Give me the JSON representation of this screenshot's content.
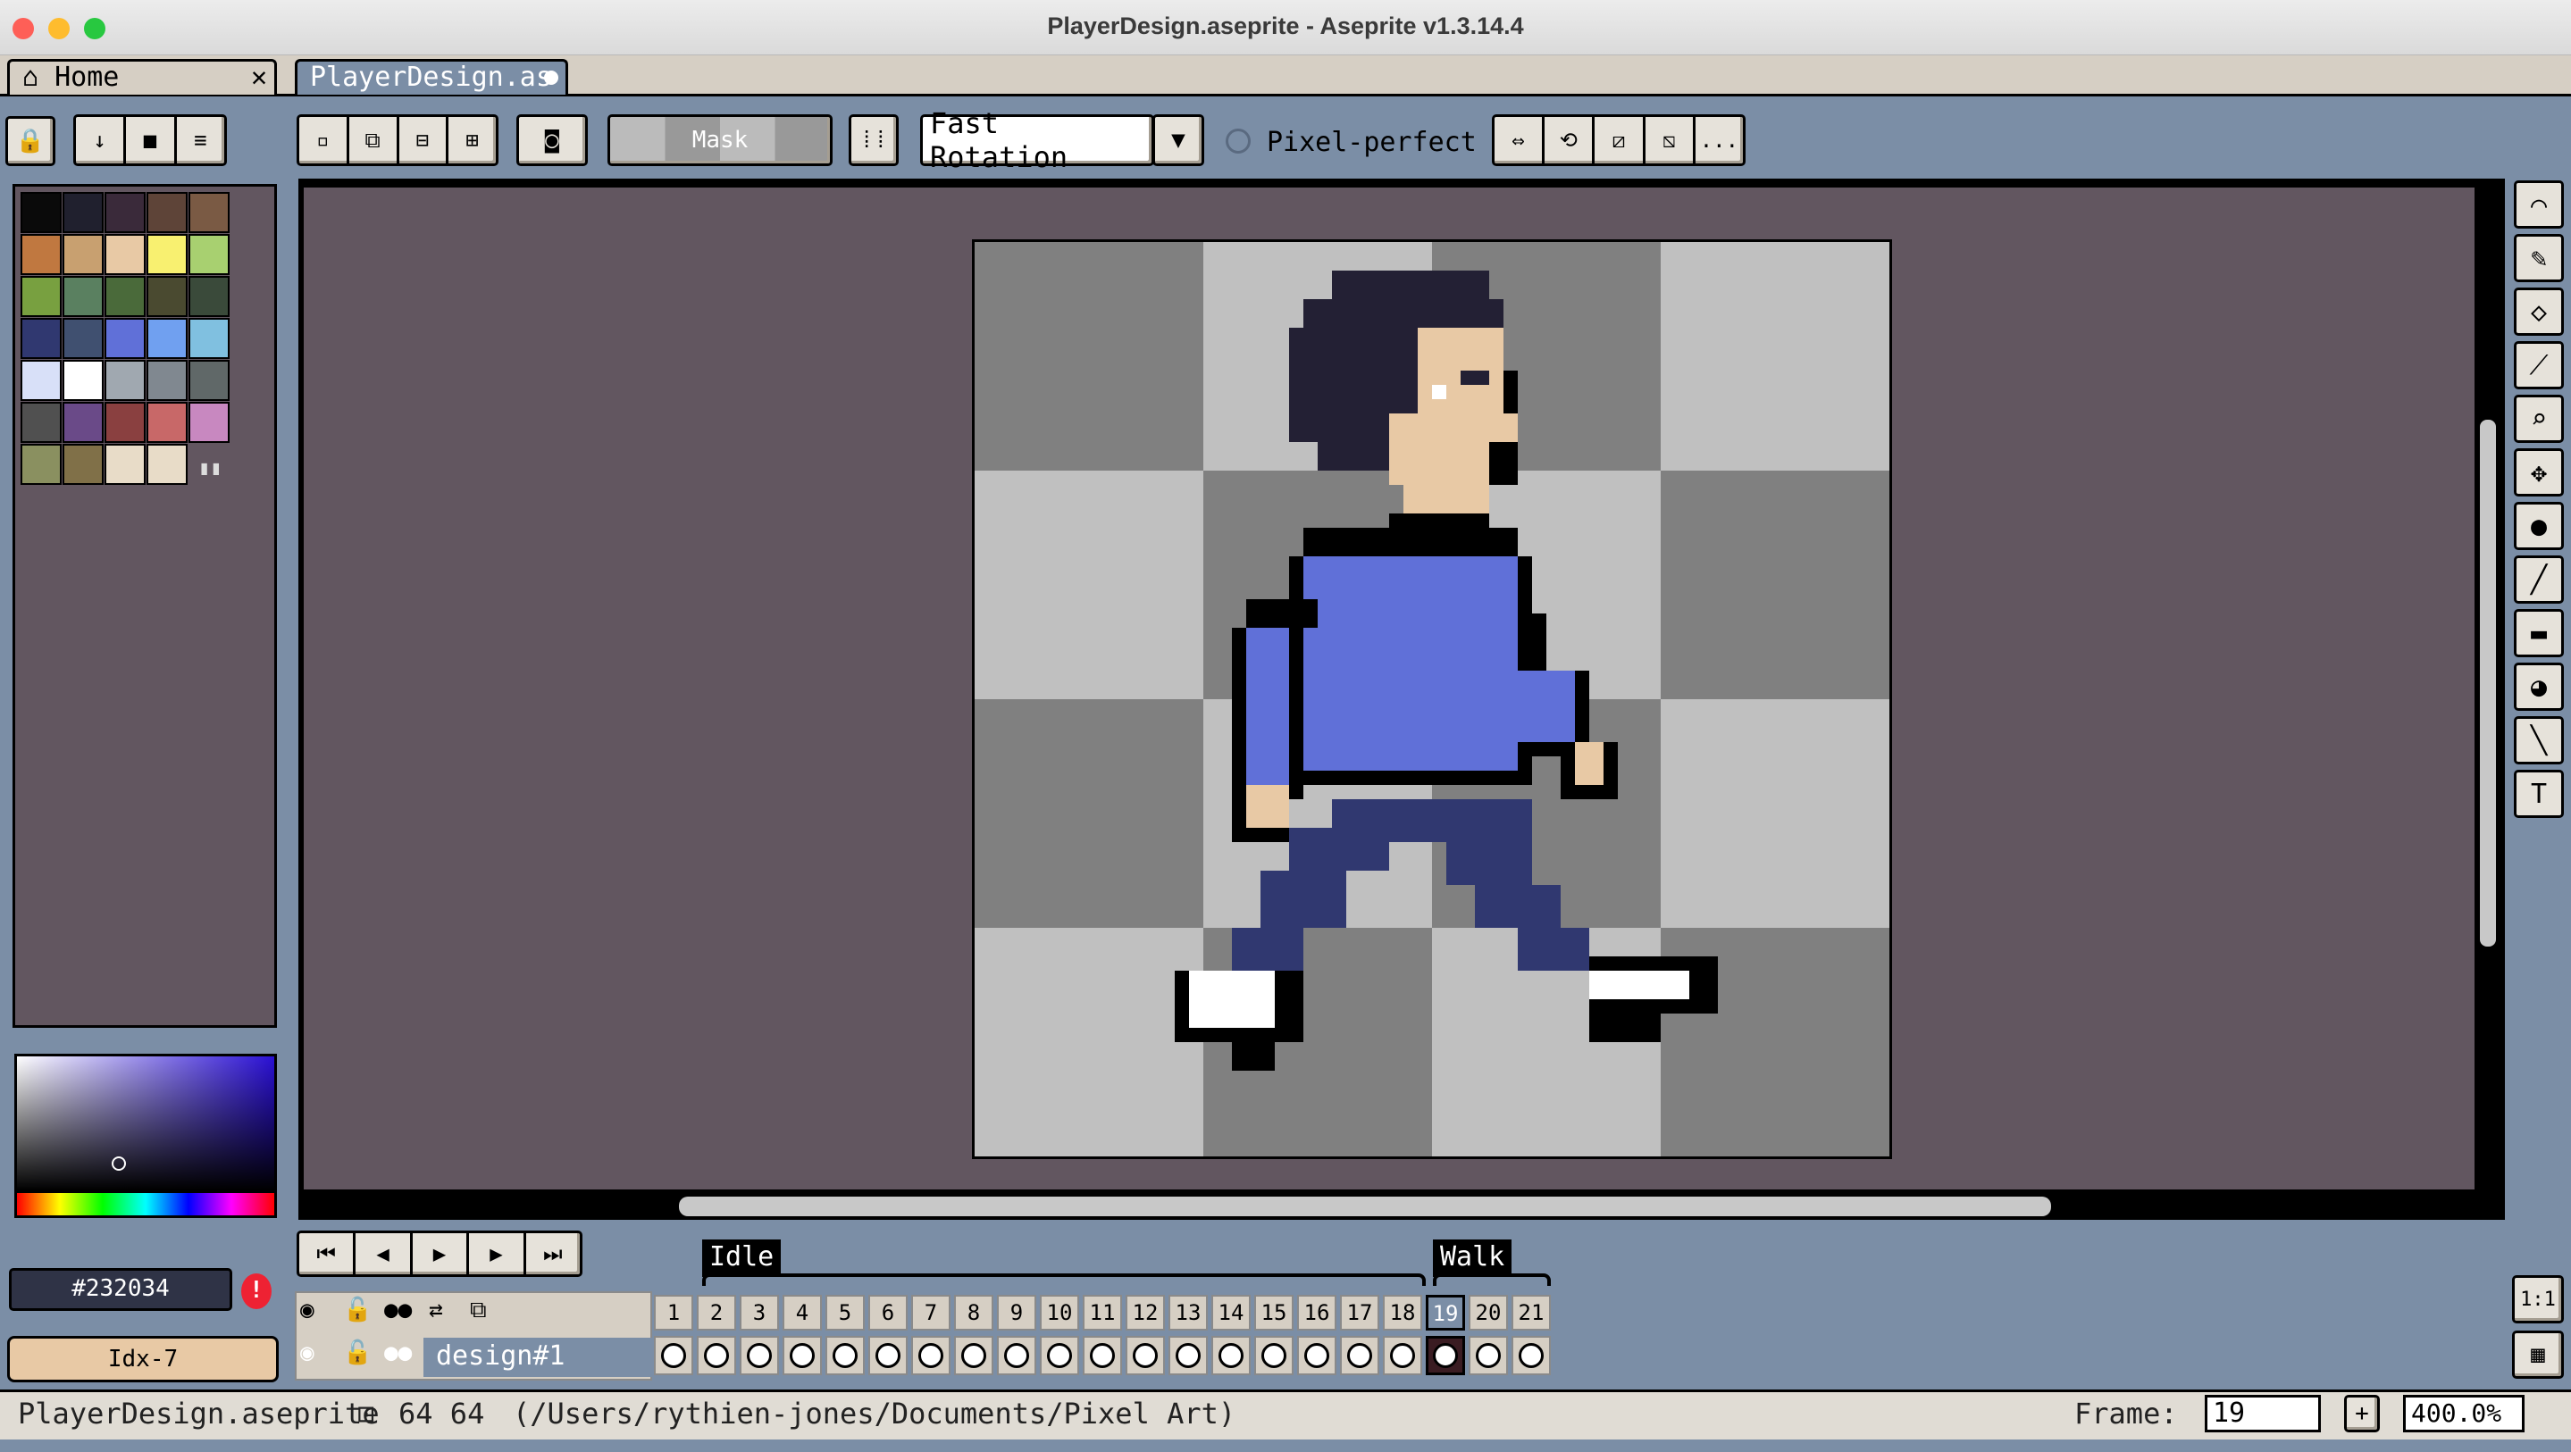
{
  "window": {
    "title": "PlayerDesign.aseprite - Aseprite v1.3.14.4"
  },
  "tabs": [
    {
      "label": "Home",
      "close": "✕"
    },
    {
      "label": "PlayerDesign.as"
    }
  ],
  "toolbar": {
    "mask_label": "Mask",
    "rotation_algorithm": "Fast Rotation",
    "pixel_perfect_label": "Pixel-perfect",
    "more_label": "..."
  },
  "palette": {
    "colors": [
      "#0a0a0a",
      "#20202e",
      "#3a2a3a",
      "#5e4438",
      "#7a5a44",
      "#c07840",
      "#c8a070",
      "#e8c9a5",
      "#f8f070",
      "#a8d070",
      "#78a040",
      "#5a8060",
      "#4a6a3a",
      "#4a4a30",
      "#3a4a3a",
      "#303870",
      "#405070",
      "#6070d8",
      "#70a0f0",
      "#80c0e0",
      "#d8e0f8",
      "#ffffff",
      "#a0a8b0",
      "#808890",
      "#606868",
      "#505050",
      "#6a4a88",
      "#8a4040",
      "#c86868",
      "#c888c0",
      "#8a9060",
      "#807048",
      "#e8dcc8",
      "#e8dcc8"
    ]
  },
  "color": {
    "hex": "#232034",
    "index": "Idx-7"
  },
  "timeline": {
    "tags": [
      {
        "name": "Idle"
      },
      {
        "name": "Walk"
      }
    ],
    "frames": [
      "1",
      "2",
      "3",
      "4",
      "5",
      "6",
      "7",
      "8",
      "9",
      "10",
      "11",
      "12",
      "13",
      "14",
      "15",
      "16",
      "17",
      "18",
      "19",
      "20",
      "21"
    ],
    "current_frame": "19",
    "layer_name": "design#1"
  },
  "status": {
    "filename": "PlayerDesign.aseprite",
    "size": "64 64",
    "path": "(/Users/rythien-jones/Documents/Pixel Art)",
    "frame_label": "Frame:",
    "frame_value": "19",
    "zoom": "400.0%"
  },
  "side": {
    "ratio_label": "1:1"
  }
}
